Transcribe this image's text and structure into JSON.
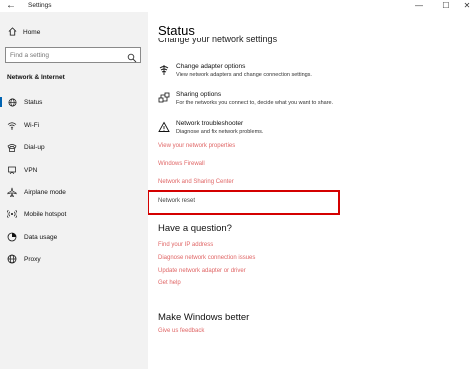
{
  "window": {
    "title": "Settings",
    "back_glyph": "←",
    "minimize_glyph": "—",
    "maximize_glyph": "☐",
    "close_glyph": "✕"
  },
  "sidebar": {
    "home_label": "Home",
    "search_placeholder": "Find a setting",
    "section_label": "Network & Internet",
    "items": [
      {
        "label": "Status",
        "icon": "globe-icon",
        "selected": true
      },
      {
        "label": "Wi-Fi",
        "icon": "wifi-icon",
        "selected": false
      },
      {
        "label": "Dial-up",
        "icon": "dialup-icon",
        "selected": false
      },
      {
        "label": "VPN",
        "icon": "vpn-icon",
        "selected": false
      },
      {
        "label": "Airplane mode",
        "icon": "airplane-icon",
        "selected": false
      },
      {
        "label": "Mobile hotspot",
        "icon": "hotspot-icon",
        "selected": false
      },
      {
        "label": "Data usage",
        "icon": "data-usage-icon",
        "selected": false
      },
      {
        "label": "Proxy",
        "icon": "proxy-icon",
        "selected": false
      }
    ]
  },
  "main": {
    "title": "Status",
    "cut_heading": "Change your network settings",
    "settings": [
      {
        "title": "Change adapter options",
        "desc": "View network adapters and change connection settings.",
        "icon": "adapter-icon"
      },
      {
        "title": "Sharing options",
        "desc": "For the networks you connect to, decide what you want to share.",
        "icon": "sharing-icon"
      },
      {
        "title": "Network troubleshooter",
        "desc": "Diagnose and fix network problems.",
        "icon": "warning-icon"
      }
    ],
    "links": {
      "view_properties": "View your network properties",
      "windows_firewall": "Windows Firewall",
      "sharing_center": "Network and Sharing Center",
      "network_reset": "Network reset"
    },
    "question_heading": "Have a question?",
    "question_links": [
      "Find your IP address",
      "Diagnose network connection issues",
      "Update network adapter or driver",
      "Get help"
    ],
    "better_heading": "Make Windows better",
    "feedback_link": "Give us feedback"
  },
  "colors": {
    "link": "#e06666",
    "highlight_box": "#d40000",
    "sidebar_bg": "#f2f2f2",
    "accent": "#0063b1"
  }
}
